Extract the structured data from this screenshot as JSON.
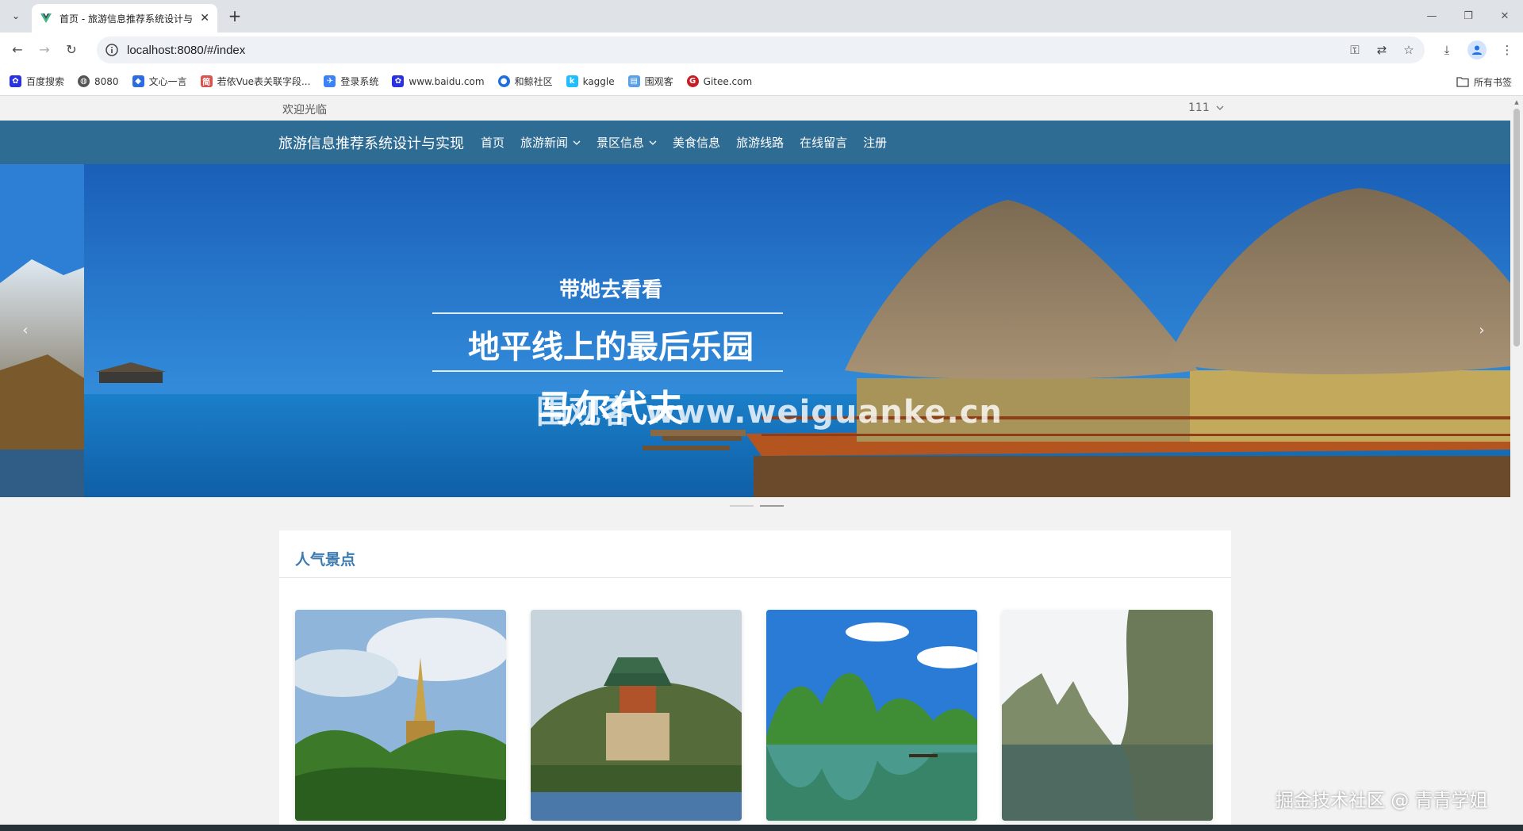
{
  "browser": {
    "tab_title": "首页 - 旅游信息推荐系统设计与",
    "url": "localhost:8080/#/index",
    "bookmarks": [
      {
        "label": "百度搜索",
        "icon": "paw-icon",
        "color": "#2932e1"
      },
      {
        "label": "8080",
        "icon": "globe-icon",
        "color": "#555555"
      },
      {
        "label": "文心一言",
        "icon": "cube-icon",
        "color": "#2d6cdf"
      },
      {
        "label": "若依Vue表关联字段...",
        "icon": "bookmark-icon",
        "color": "#d9534f"
      },
      {
        "label": "登录系统",
        "icon": "bird-icon",
        "color": "#3b82f6"
      },
      {
        "label": "www.baidu.com",
        "icon": "paw-icon",
        "color": "#2932e1"
      },
      {
        "label": "和鲸社区",
        "icon": "whale-icon",
        "color": "#1e6fd9"
      },
      {
        "label": "kaggle",
        "icon": "k-icon",
        "color": "#20beff"
      },
      {
        "label": "围观客",
        "icon": "doc-icon",
        "color": "#5aa0e6"
      },
      {
        "label": "Gitee.com",
        "icon": "gitee-icon",
        "color": "#c71d23"
      }
    ],
    "all_bookmarks": "所有书签"
  },
  "page": {
    "welcome": "欢迎光临",
    "username": "111",
    "brand": "旅游信息推荐系统设计与实现",
    "nav": [
      {
        "label": "首页",
        "dropdown": false
      },
      {
        "label": "旅游新闻",
        "dropdown": true
      },
      {
        "label": "景区信息",
        "dropdown": true
      },
      {
        "label": "美食信息",
        "dropdown": false
      },
      {
        "label": "旅游线路",
        "dropdown": false
      },
      {
        "label": "在线留言",
        "dropdown": false
      },
      {
        "label": "注册",
        "dropdown": false
      }
    ],
    "banner": {
      "line1": "带她去看看",
      "line2": "地平线上的最后乐园",
      "line3": "马尔代夫",
      "overlay": "围观客 www.weiguanke.cn",
      "prev_icon": "‹",
      "next_icon": "›"
    },
    "section_title": "人气景点",
    "accent_color": "#2f6c94"
  },
  "watermark": "掘金技术社区 @ 青青学姐"
}
